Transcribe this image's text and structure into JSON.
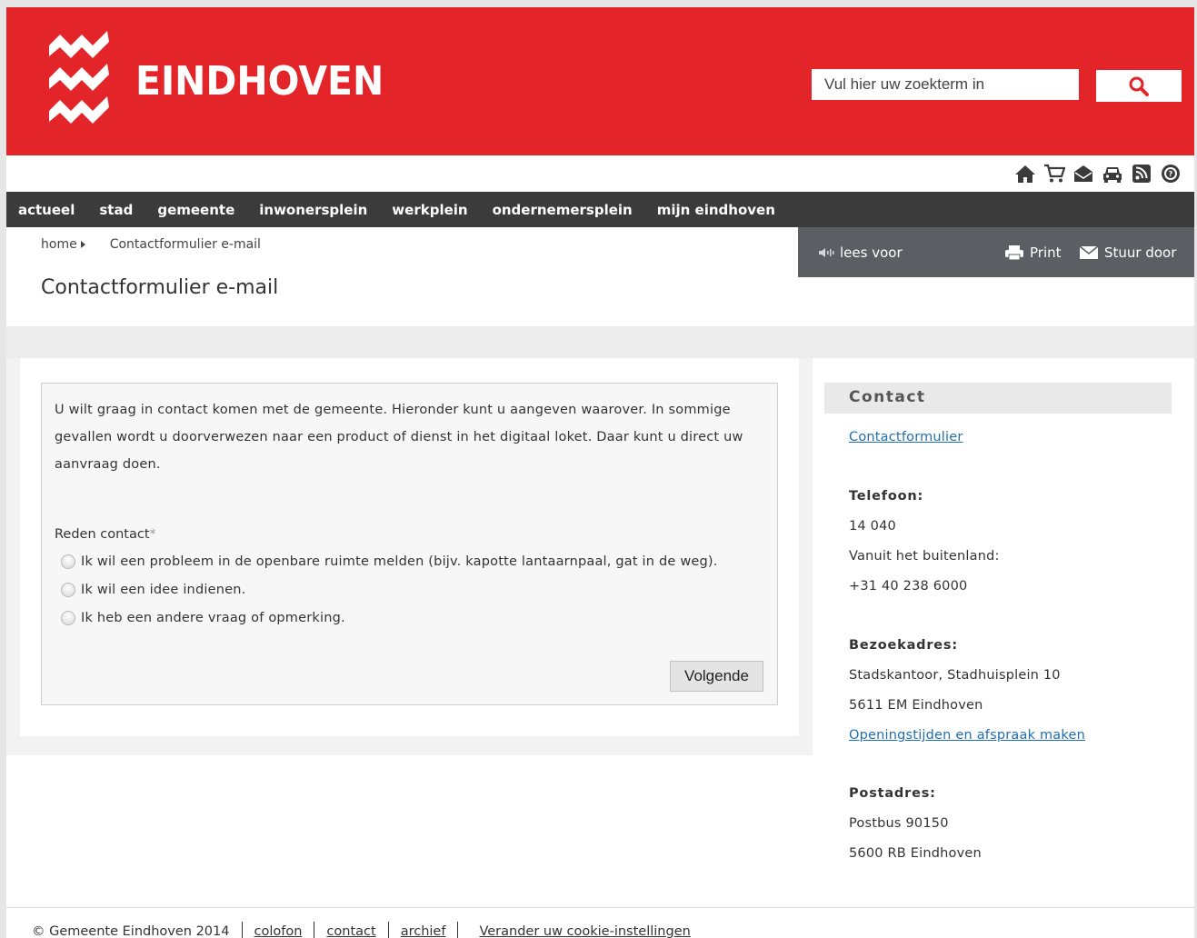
{
  "header": {
    "logo_text": "EINDHOVEN",
    "search_placeholder": "Vul hier uw zoekterm in",
    "brand_color": "#e32428"
  },
  "iconbar": [
    "home-icon",
    "cart-icon",
    "mail-icon",
    "car-icon",
    "rss-icon",
    "help-icon"
  ],
  "nav": {
    "items": [
      "actueel",
      "stad",
      "gemeente",
      "inwonersplein",
      "werkplein",
      "ondernemersplein",
      "mijn eindhoven"
    ]
  },
  "breadcrumb": {
    "home": "home",
    "current": "Contactformulier e-mail"
  },
  "page_title": "Contactformulier e-mail",
  "toolbar": {
    "read_label": "lees voor",
    "print_label": "Print",
    "send_label": "Stuur door"
  },
  "form": {
    "intro": "U wilt graag in contact komen met de gemeente. Hieronder kunt u aangeven waarover. In sommige gevallen wordt u doorverwezen naar een product of dienst in het digitaal loket. Daar kunt u direct uw aanvraag doen.",
    "reason_label": "Reden contact",
    "required_mark": "*",
    "options": [
      "Ik wil een probleem in de openbare ruimte melden (bijv. kapotte lantaarnpaal, gat in de weg).",
      "Ik wil een idee indienen.",
      "Ik heb een andere vraag of opmerking."
    ],
    "next_label": "Volgende"
  },
  "contact": {
    "heading": "Contact",
    "form_link": "Contactformulier",
    "phone_heading": "Telefoon:",
    "phone": "14 040",
    "abroad_label": "Vanuit het buitenland:",
    "abroad_phone": "+31 40 238 6000",
    "visit_heading": "Bezoekadres:",
    "visit_line1": "Stadskantoor, Stadhuisplein 10",
    "visit_line2": "5611 EM Eindhoven",
    "hours_link": "Openingstijden en afspraak maken",
    "post_heading": "Postadres:",
    "post_line1": "Postbus 90150",
    "post_line2": "5600 RB Eindhoven"
  },
  "footer": {
    "copyright": "© Gemeente Eindhoven 2014",
    "links": [
      "colofon",
      "contact",
      "archief",
      "Verander uw cookie-instellingen"
    ]
  }
}
